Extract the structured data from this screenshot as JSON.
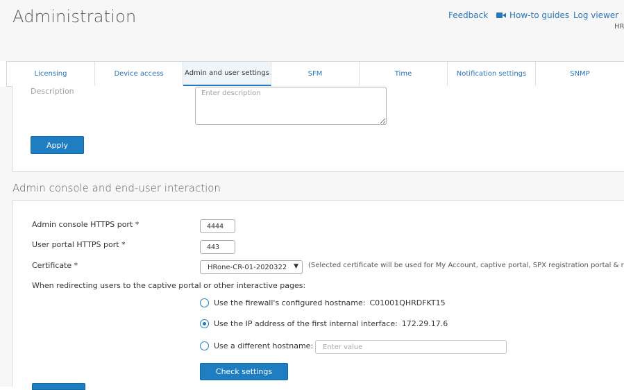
{
  "header": {
    "title": "Administration",
    "links": {
      "feedback": "Feedback",
      "howto": "How-to guides",
      "logviewer": "Log viewer"
    },
    "user_fragment": "HR"
  },
  "tabs": [
    {
      "label": "Licensing",
      "active": false
    },
    {
      "label": "Device access",
      "active": false
    },
    {
      "label": "Admin and user settings",
      "active": true
    },
    {
      "label": "SFM",
      "active": false
    },
    {
      "label": "Time",
      "active": false
    },
    {
      "label": "Notification settings",
      "active": false
    },
    {
      "label": "SNMP",
      "active": false
    }
  ],
  "hostname_panel": {
    "description_label": "Description",
    "description_placeholder": "Enter description",
    "apply_label": "Apply"
  },
  "admin_console": {
    "section_title": "Admin console and end-user interaction",
    "admin_port_label": "Admin console HTTPS port *",
    "admin_port_value": "4444",
    "user_port_label": "User portal HTTPS port *",
    "user_port_value": "443",
    "certificate_label": "Certificate *",
    "certificate_value": "HRone-CR-01-2020322",
    "certificate_note": "(Selected certificate will be used for My Account, captive portal, SPX registration portal & re",
    "redirect_label": "When redirecting users to the captive portal or other interactive pages:",
    "options": [
      {
        "label": "Use the firewall's configured hostname:",
        "value": "C01001QHRDFKT15",
        "checked": false
      },
      {
        "label": "Use the IP address of the first internal interface:",
        "value": "172.29.17.6",
        "checked": true
      },
      {
        "label": "Use a different hostname:",
        "value": "",
        "checked": false
      }
    ],
    "hostname_placeholder": "Enter value",
    "check_settings_label": "Check settings"
  },
  "colors": {
    "accent": "#1f7ec1",
    "link": "#2a76b8",
    "background": "#f7f7f7"
  },
  "icons": {
    "howto": "video-camera-icon",
    "dropdown": "chevron-down-icon"
  }
}
